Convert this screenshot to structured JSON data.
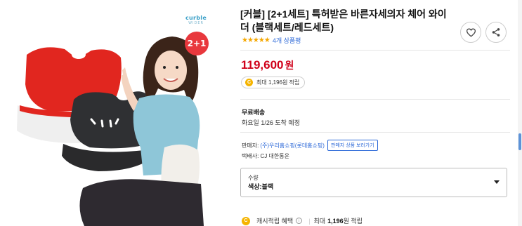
{
  "product": {
    "title": "[커블] [2+1세트] 특허받은 바른자세의자 체어 와이더 (블랙세트/레드세트)",
    "review_count_text": "4개 상품평",
    "stars": "★★★★★",
    "price": "119,600",
    "currency": "원",
    "points_text": "최대 1,196원 적립",
    "coin_symbol": "C"
  },
  "image": {
    "brand_line1": "curble",
    "brand_line2": "WIDER",
    "badge": "2+1"
  },
  "shipping": {
    "title": "무료배송",
    "arrival": "화요일 1/26 도착 예정"
  },
  "seller": {
    "label": "판매자:",
    "name": "(주)우리홈쇼핑(롯데홈쇼핑)",
    "button": "판매자 상품 보러가기",
    "courier": "택배사: CJ 대한통운"
  },
  "option": {
    "label": "수량",
    "value": "색상:블랙"
  },
  "cashback": {
    "label": "캐시적립 혜택",
    "info": "i",
    "separator": "|",
    "prefix": "최대",
    "amount": "1,196",
    "suffix": "원 적립"
  },
  "colors": {
    "accent_red": "#d0021b",
    "link_blue": "#2e6ad8",
    "star": "#f5a700",
    "coin": "#f5b400"
  }
}
